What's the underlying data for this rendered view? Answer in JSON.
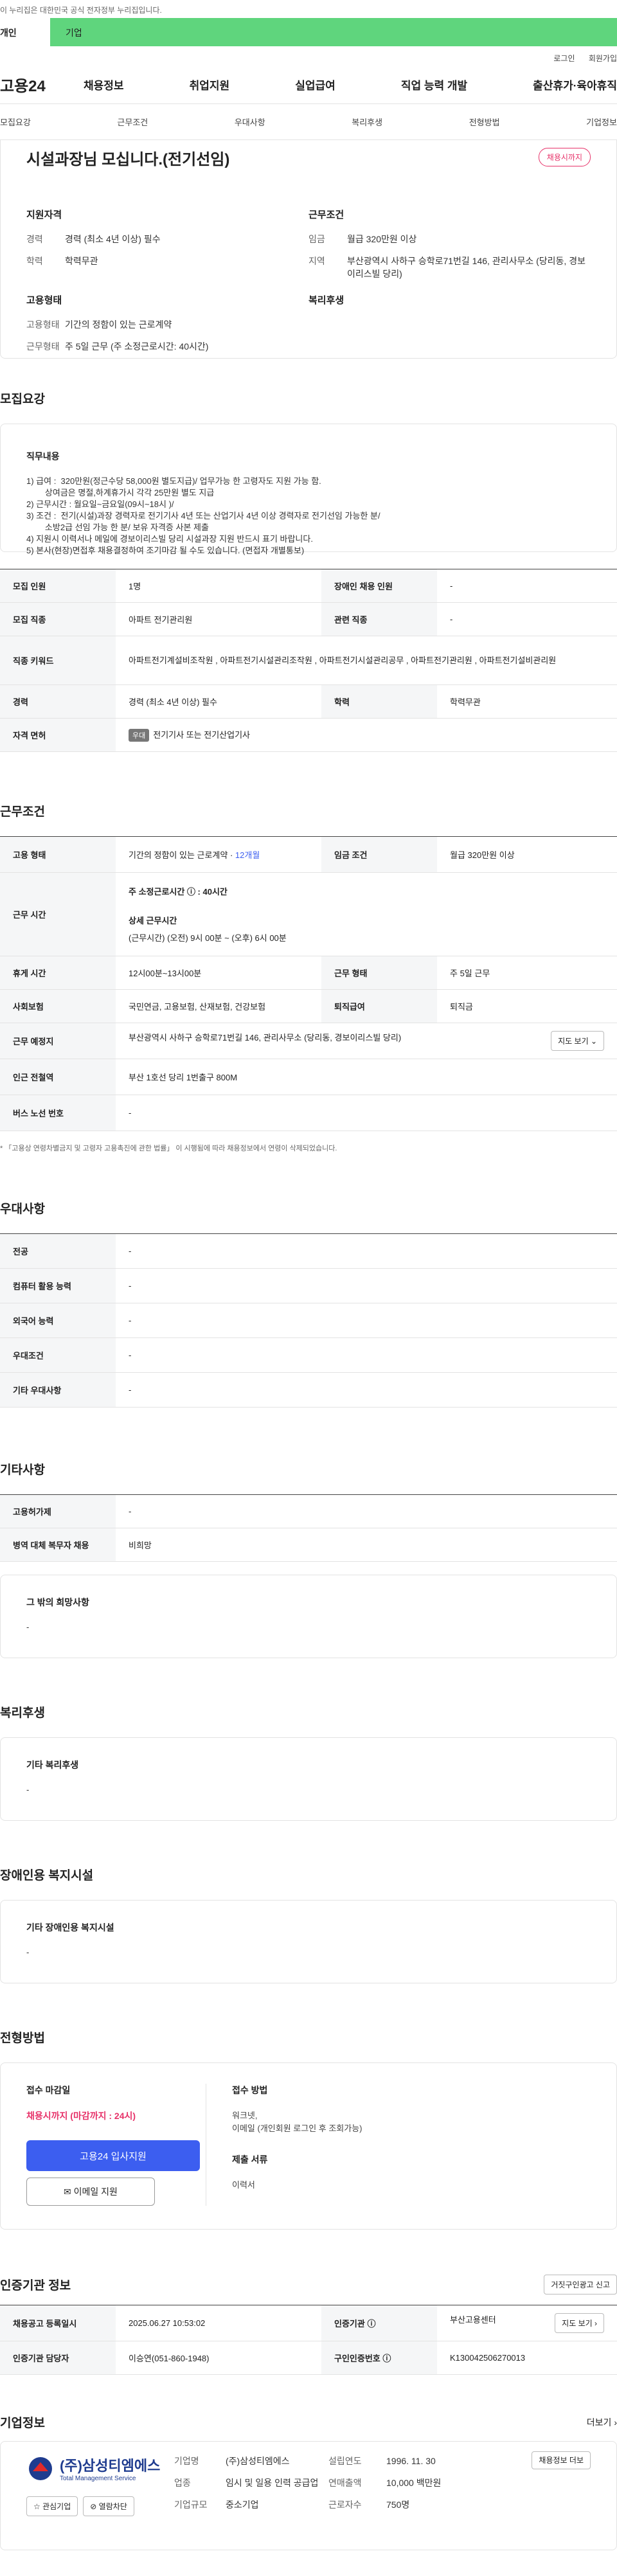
{
  "top_notice": "이 누리집은 대한민국 공식 전자정부 누리집입니다.",
  "header": {
    "tab_personal": "개인",
    "tab_company": "기업",
    "util_login": "로그인",
    "util_join": "회원가입",
    "logo": "고용24",
    "menu": [
      "채용정보",
      "취업지원",
      "실업급여",
      "직업 능력 개발",
      "출산휴가·육아휴직"
    ]
  },
  "anchors": [
    "모집요강",
    "근무조건",
    "우대사항",
    "복리후생",
    "전형방법",
    "기업정보"
  ],
  "summary": {
    "title": "시설과장님 모십니다.(전기선임)",
    "deadline_badge": "채용시까지",
    "qual_head": "지원자격",
    "career_k": "경력",
    "career_v": "경력 (최소 4년 이상) 필수",
    "edu_k": "학력",
    "edu_v": "학력무관",
    "emp_head": "고용형태",
    "emptype_k": "고용형태",
    "emptype_v": "기간의 정함이 있는 근로계약",
    "worktype_k": "근무형태",
    "worktype_v": "주 5일 근무 (주 소정근로시간: 40시간)",
    "cond_head": "근무조건",
    "wage_k": "임금",
    "wage_v": "월급 320만원 이상",
    "region_k": "지역",
    "region_v": "부산광역시 사하구 승학로71번길 146, 관리사무소 (당리동, 경보이리스빌 당리)",
    "welfare_head": "복리후생"
  },
  "recruit": {
    "section": "모집요강",
    "job_head": "직무내용",
    "job_desc": "1) 급여 :  320만원(정근수당 58,000원 별도지급)/ 업무가능 한 고령자도 지원 가능 함.\n        상여금은 명절,하계휴가시 각각 25만원 별도 지급\n2) 근무시간 : 월요일~금요일(09시~18시 )/\n3) 조건 :  전기(시설)과장 경력자로 전기기사 4년 또는 산업기사 4년 이상 경력자로 전기선임 가능한 분/\n        소방2급 선임 가능 한 분/ 보유 자격증 사본 제출\n4) 지원시 이력서나 메일에 경보이리스빌 당리 시설과장 지원 반드시 표기 바랍니다.\n5) 본사(현장)면접후 채용결정하여 조기마감 될 수도 있습니다. (면접자 개별통보)",
    "rows": {
      "count_k": "모집 인원",
      "count_v": "1명",
      "disabled_k": "장애인 채용 인원",
      "disabled_v": "-",
      "job_k": "모집 직종",
      "job_v": "아파트 전기관리원",
      "rel_k": "관련 직종",
      "rel_v": "-",
      "kw_k": "직종 키워드",
      "kw_v": "아파트전기계설비조작원 , 아파트전기시설관리조작원 , 아파트전기시설관리공무 , 아파트전기관리원 , 아파트전기설비관리원",
      "career_k": "경력",
      "career_v": "경력 (최소 4년 이상) 필수",
      "edu_k": "학력",
      "edu_v": "학력무관",
      "license_k": "자격 면허",
      "license_chip": "우대",
      "license_v": "전기기사 또는 전기산업기사"
    }
  },
  "work": {
    "section": "근무조건",
    "emp_k": "고용 형태",
    "emp_v": "기간의 정함이 있는 근로계약 · ",
    "emp_months": "12개월",
    "wage_k": "임금 조건",
    "wage_v": "월급 320만원 이상",
    "hours_k": "근무 시간",
    "hours_week": "주 소정근로시간 ⓘ : 40시간",
    "hours_detail_head": "상세 근무시간",
    "hours_detail": "(근무시간) (오전) 9시 00분 ~ (오후) 6시 00분",
    "break_k": "휴게 시간",
    "break_v": "12시00분~13시00분",
    "form_k": "근무 형태",
    "form_v": "주 5일 근무",
    "ins_k": "사회보험",
    "ins_v": "국민연금, 고용보험, 산재보험, 건강보험",
    "retire_k": "퇴직급여",
    "retire_v": "퇴직금",
    "place_k": "근무 예정지",
    "place_v": "부산광역시 사하구 승학로71번길 146, 관리사무소 (당리동, 경보이리스빌 당리)",
    "map_btn": "지도 보기 ⌄",
    "subway_k": "인근 전철역",
    "subway_v": "부산 1호선 당리 1번출구 800M",
    "bus_k": "버스 노선 번호",
    "bus_v": "-",
    "note": "* 「고용상 연령차별금지 및 고령자 고용촉진에 관한 법률」 이 시행됨에 따라 채용정보에서 연령이 삭제되었습니다."
  },
  "pref": {
    "section": "우대사항",
    "major_k": "전공",
    "major_v": "-",
    "pc_k": "컴퓨터 활용 능력",
    "pc_v": "-",
    "lang_k": "외국어 능력",
    "lang_v": "-",
    "cond_k": "우대조건",
    "cond_v": "-",
    "etc_k": "기타 우대사항",
    "etc_v": "-"
  },
  "other": {
    "section": "기타사항",
    "ins_k": "고용허가제",
    "ins_v": "-",
    "mil_k": "병역 대체 복무자 채용",
    "mil_v": "비희망",
    "box_head": "그 밖의 희망사항",
    "box_v": "-"
  },
  "welfare": {
    "section": "복리후생",
    "head": "기타 복리후생",
    "v": "-"
  },
  "disabled": {
    "section": "장애인용 복지시설",
    "head": "기타 장애인용 복지시설",
    "v": "-"
  },
  "process": {
    "section": "전형방법",
    "deadline_head": "접수 마감일",
    "deadline_v": "채용시까지 (마감까지 : 24시)",
    "apply_btn": "고용24 입사지원",
    "email_btn": "✉ 이메일 지원",
    "method_head": "접수 방법",
    "method_v": "워크넷,\n이메일 (개인회원 로그인 후 조회가능)",
    "docs_head": "제출 서류",
    "docs_v": "이력서"
  },
  "cert": {
    "section": "인증기관 정보",
    "btn": "거짓구인광고 신고",
    "reg_k": "채용공고 등록일시",
    "reg_v": "2025.06.27 10:53:02",
    "org_k": "인증기관 ⓘ",
    "org_v": "부산고용센터",
    "map_btn": "지도 보기 ›",
    "mgr_k": "인증기관 담당자",
    "mgr_v": "이승연(051-860-1948)",
    "no_k": "구인인증번호 ⓘ",
    "no_v": "K130042506270013"
  },
  "company": {
    "section": "기업정보",
    "more": "더보기 ›",
    "logo_name": "(주)삼성티엠에스",
    "logo_sub": "Total Management Service",
    "fav_btn": "☆ 관심기업",
    "block_btn": "⊘ 열람차단",
    "name_k": "기업명",
    "name_v": "(주)삼성티엠에스",
    "ind_k": "업종",
    "ind_v": "임시 및 일용 인력 공급업",
    "scale_k": "기업규모",
    "scale_v": "중소기업",
    "year_k": "설립연도",
    "year_v": "1996. 11. 30",
    "sales_k": "연매출액",
    "sales_v": "10,000 백만원",
    "emp_k": "근로자수",
    "emp_v": "750명",
    "jobs_btn": "채용정보 더보"
  }
}
